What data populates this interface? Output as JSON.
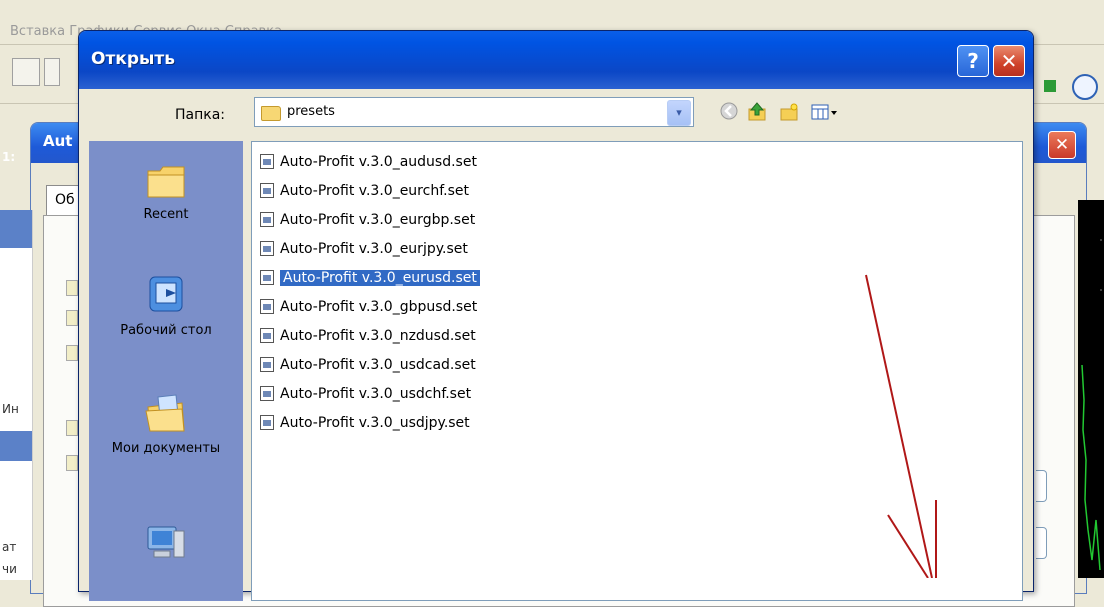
{
  "background": {
    "menu_text": "Вставка   Графики   Сервис   Окна   Справка",
    "dialog_title": "Aut",
    "tab_label": "Об",
    "left_fragments": [
      "1:",
      "Ин",
      "ат",
      "чи"
    ]
  },
  "dialog": {
    "title": "Открыть",
    "help_label": "?",
    "close_label": "✕",
    "folder_label": "Папка:",
    "folder_value": "presets",
    "combo_arrow": "▾"
  },
  "toolbar_icons": [
    "back-icon",
    "up-folder-icon",
    "new-folder-icon",
    "view-menu-icon"
  ],
  "places": [
    {
      "label": "Recent",
      "icon": "recent-folder-icon"
    },
    {
      "label": "Рабочий стол",
      "icon": "desktop-icon"
    },
    {
      "label": "Мои документы",
      "icon": "my-documents-icon"
    },
    {
      "label": "",
      "icon": "my-computer-icon"
    }
  ],
  "files": [
    {
      "name": "Auto-Profit v.3.0_audusd.set",
      "selected": false
    },
    {
      "name": "Auto-Profit v.3.0_eurchf.set",
      "selected": false
    },
    {
      "name": "Auto-Profit v.3.0_eurgbp.set",
      "selected": false
    },
    {
      "name": "Auto-Profit v.3.0_eurjpy.set",
      "selected": false
    },
    {
      "name": "Auto-Profit v.3.0_eurusd.set",
      "selected": true
    },
    {
      "name": "Auto-Profit v.3.0_gbpusd.set",
      "selected": false
    },
    {
      "name": "Auto-Profit v.3.0_nzdusd.set",
      "selected": false
    },
    {
      "name": "Auto-Profit v.3.0_usdcad.set",
      "selected": false
    },
    {
      "name": "Auto-Profit v.3.0_usdchf.set",
      "selected": false
    },
    {
      "name": "Auto-Profit v.3.0_usdjpy.set",
      "selected": false
    }
  ],
  "colors": {
    "title_bar": "#0054e3",
    "selection": "#316ac5",
    "places_bar": "#7b8fc9",
    "annotation_arrow": "#b01818"
  }
}
